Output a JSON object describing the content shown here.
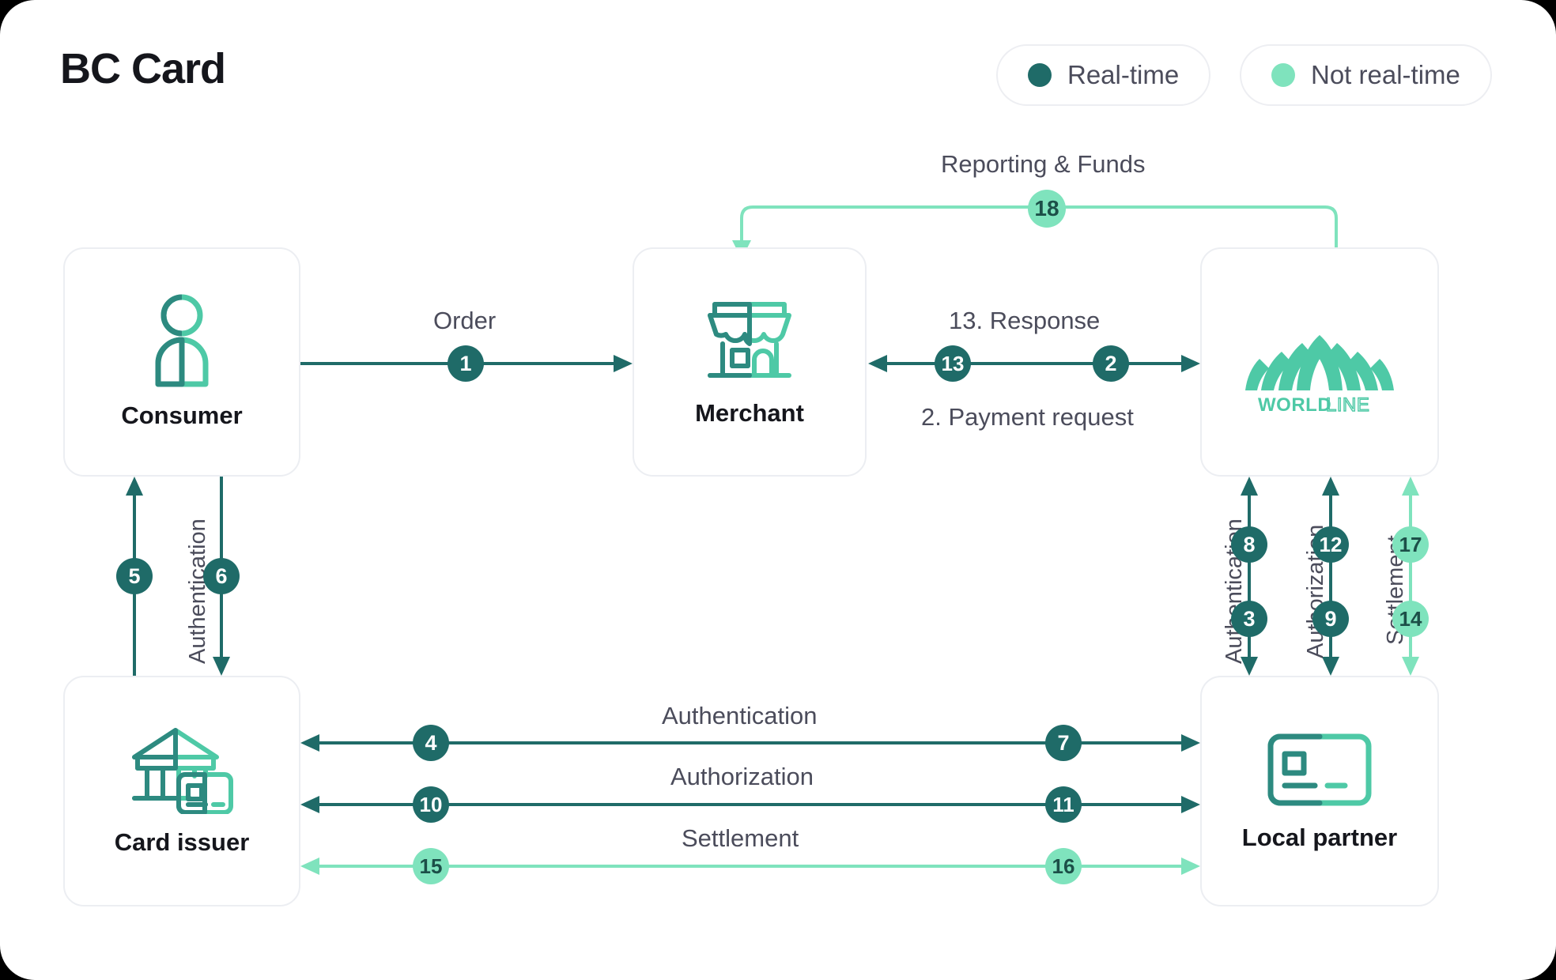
{
  "header": {
    "title": "BC Card",
    "legend": [
      {
        "label": "Real-time",
        "color": "#1f6b68",
        "key": "real-time"
      },
      {
        "label": "Not real-time",
        "color": "#7fe3bd",
        "key": "not-real-time"
      }
    ]
  },
  "colors": {
    "realtime": "#1f6b68",
    "not_realtime": "#7fe3bd",
    "icon_dark": "#2d8a80",
    "icon_light": "#4ec9a6",
    "text": "#4b4c5b",
    "heading": "#15161c",
    "card_border": "#eceef2"
  },
  "nodes": [
    {
      "id": "consumer",
      "label": "Consumer",
      "icon": "person-icon"
    },
    {
      "id": "merchant",
      "label": "Merchant",
      "icon": "storefront-icon"
    },
    {
      "id": "worldline",
      "label": "Worldline",
      "icon": "worldline-logo"
    },
    {
      "id": "card-issuer",
      "label": "Card issuer",
      "icon": "bank-card-icon"
    },
    {
      "id": "local-partner",
      "label": "Local partner",
      "icon": "credit-card-icon"
    }
  ],
  "logo": {
    "word_bold": "WORLD",
    "word_light": "LINE"
  },
  "flows": {
    "order": {
      "label": "Order",
      "badges": [
        "1"
      ],
      "type": "real-time"
    },
    "response": {
      "label": "13. Response",
      "badges": [
        "13"
      ],
      "type": "real-time"
    },
    "payment_request": {
      "label": "2. Payment request",
      "badges": [
        "2"
      ],
      "type": "real-time"
    },
    "reporting_funds": {
      "label": "Reporting & Funds",
      "badges": [
        "18"
      ],
      "type": "not-real-time"
    },
    "consumer_auth": {
      "label": "Authentication",
      "badges": [
        "5",
        "6"
      ],
      "type": "real-time"
    },
    "wl_auth": {
      "label": "Authentication",
      "badges": [
        "8",
        "3"
      ],
      "type": "real-time"
    },
    "wl_authz": {
      "label": "Authorization",
      "badges": [
        "12",
        "9"
      ],
      "type": "real-time"
    },
    "wl_settlement": {
      "label": "Settlement",
      "badges": [
        "17",
        "14"
      ],
      "type": "not-real-time"
    },
    "row_auth": {
      "label": "Authentication",
      "badges": [
        "4",
        "7"
      ],
      "type": "real-time"
    },
    "row_authz": {
      "label": "Authorization",
      "badges": [
        "10",
        "11"
      ],
      "type": "real-time"
    },
    "row_settlement": {
      "label": "Settlement",
      "badges": [
        "15",
        "16"
      ],
      "type": "not-real-time"
    }
  },
  "badges": {
    "b1": "1",
    "b2": "2",
    "b3": "3",
    "b4": "4",
    "b5": "5",
    "b6": "6",
    "b7": "7",
    "b8": "8",
    "b9": "9",
    "b10": "10",
    "b11": "11",
    "b12": "12",
    "b13": "13",
    "b14": "14",
    "b15": "15",
    "b16": "16",
    "b17": "17",
    "b18": "18"
  },
  "labels": {
    "order": "Order",
    "response": "13. Response",
    "payment_request": "2. Payment request",
    "reporting_funds": "Reporting & Funds",
    "authentication": "Authentication",
    "authorization": "Authorization",
    "settlement": "Settlement"
  }
}
